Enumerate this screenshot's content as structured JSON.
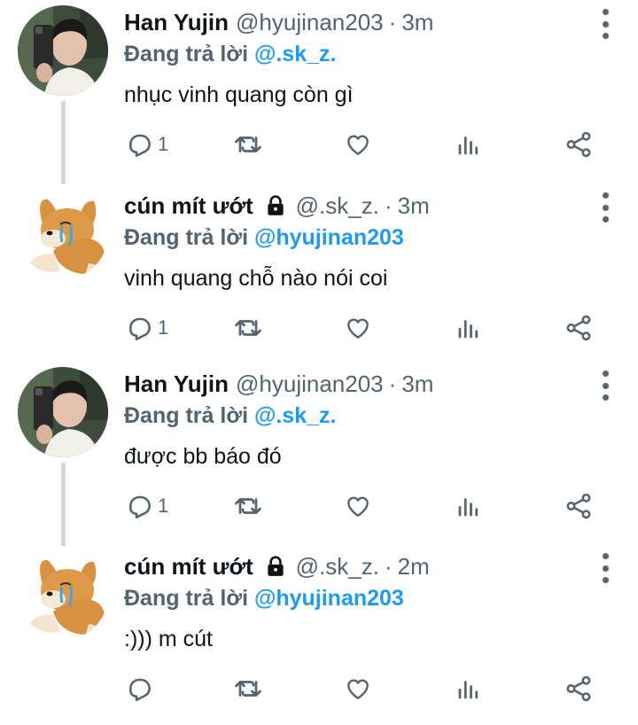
{
  "tweets": [
    {
      "name": "Han Yujin",
      "locked": false,
      "handle": "@hyujinan203",
      "time": "3m",
      "replying_label": "Đang trả lời",
      "replying_to": "@.sk_z.",
      "text": "nhục vinh quang còn gì",
      "reply_count": "1",
      "avatar": "person-selfie"
    },
    {
      "name": "cún mít ướt",
      "locked": true,
      "handle": "@.sk_z.",
      "time": "3m",
      "replying_label": "Đang trả lời",
      "replying_to": "@hyujinan203",
      "text": "vinh quang chỗ nào nói coi",
      "reply_count": "1",
      "avatar": "crying-shiba"
    },
    {
      "name": "Han Yujin",
      "locked": false,
      "handle": "@hyujinan203",
      "time": "3m",
      "replying_label": "Đang trả lời",
      "replying_to": "@.sk_z.",
      "text": "được bb báo đó",
      "reply_count": "1",
      "avatar": "person-selfie"
    },
    {
      "name": "cún mít ướt",
      "locked": true,
      "handle": "@.sk_z.",
      "time": "2m",
      "replying_label": "Đang trả lời",
      "replying_to": "@hyujinan203",
      "text": ":))) m cút",
      "reply_count": "",
      "avatar": "crying-shiba"
    }
  ],
  "dot_separator": "·",
  "icons": [
    "reply-icon",
    "retweet-icon",
    "like-icon",
    "views-icon",
    "share-icon",
    "more-icon",
    "lock-icon"
  ],
  "colors": {
    "text": "#0f1419",
    "muted": "#536471",
    "link": "#1d9bf0",
    "thread_line": "#cfd9de"
  }
}
